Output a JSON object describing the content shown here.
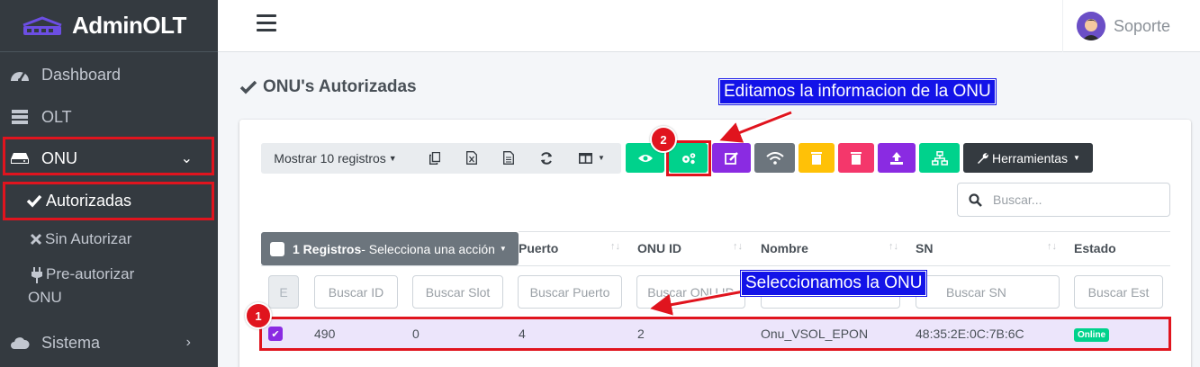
{
  "brand": {
    "name": "AdminOLT"
  },
  "sidebar": {
    "items": [
      {
        "label": "Dashboard",
        "icon": "gauge-icon"
      },
      {
        "label": "OLT",
        "icon": "server-icon"
      },
      {
        "label": "ONU",
        "icon": "hdd-icon"
      },
      {
        "label": "Autorizadas",
        "icon": "check-icon"
      },
      {
        "label": "Sin Autorizar",
        "icon": "x-icon"
      },
      {
        "label": "Pre-autorizar",
        "label2": "ONU",
        "icon": "plug-icon"
      },
      {
        "label": "Sistema",
        "icon": "cloud-icon"
      }
    ]
  },
  "topbar": {
    "user_name": "Soporte"
  },
  "page": {
    "title": "ONU's Autorizadas"
  },
  "toolbar": {
    "show_records": "Mostrar 10 registros",
    "tools_label": "Herramientas"
  },
  "search": {
    "placeholder": "Buscar..."
  },
  "table": {
    "select_action_bold": "1 Registros",
    "select_action_rest": " - Selecciona una acción",
    "columns": [
      "Puerto",
      "ONU ID",
      "Nombre",
      "SN",
      "Estado"
    ],
    "filters": [
      "E",
      "Buscar ID",
      "Buscar Slot",
      "Buscar Puerto",
      "Buscar ONU ID",
      "Buscar SN",
      "Buscar Est"
    ],
    "row": {
      "id": "490",
      "slot": "0",
      "port": "4",
      "onu_id": "2",
      "name": "Onu_VSOL_EPON",
      "sn": "48:35:2E:0C:7B:6C",
      "status": "Online"
    }
  },
  "annotations": {
    "callout1": "Seleccionamos la ONU",
    "callout2": "Editamos la informacion de la ONU",
    "badge1": "1",
    "badge2": "2"
  },
  "colors": {
    "sidebar": "#343a40",
    "highlight": "#e0141e",
    "callout": "#1313e8",
    "green": "#00d28c",
    "purple": "#8a2be2",
    "gray": "#6c757d",
    "yellow": "#ffc107",
    "pink": "#f4376b"
  }
}
